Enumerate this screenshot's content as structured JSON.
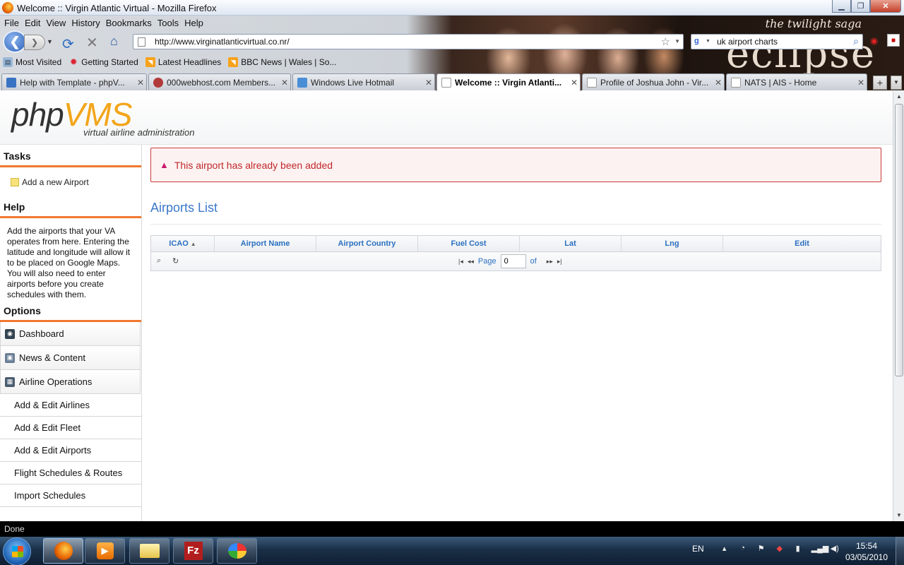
{
  "window": {
    "title": "Welcome :: Virgin Atlantic Virtual - Mozilla Firefox",
    "controls": {
      "minimize": "▁",
      "maximize": "❐",
      "close": "✕"
    }
  },
  "banner": {
    "brand": "eclipse",
    "saga": "the twilight saga"
  },
  "menu": [
    "File",
    "Edit",
    "View",
    "History",
    "Bookmarks",
    "Tools",
    "Help"
  ],
  "nav": {
    "url": "http://www.virginatlanticvirtual.co.nr/",
    "search_query": "uk airport charts"
  },
  "bookmarks": [
    {
      "label": "Most Visited",
      "icon": "most-visited-icon"
    },
    {
      "label": "Getting Started",
      "icon": "star-icon"
    },
    {
      "label": "Latest Headlines",
      "icon": "rss-icon"
    },
    {
      "label": "BBC News | Wales | So...",
      "icon": "rss-icon"
    }
  ],
  "tabs": [
    {
      "label": "Help with Template - phpV...",
      "active": false
    },
    {
      "label": "000webhost.com Members...",
      "active": false
    },
    {
      "label": "Windows Live Hotmail",
      "active": false
    },
    {
      "label": "Welcome :: Virgin Atlanti...",
      "active": true
    },
    {
      "label": "Profile of Joshua John - Vir...",
      "active": false
    },
    {
      "label": "NATS | AIS - Home",
      "active": false
    }
  ],
  "logo": {
    "php": "php",
    "vms": "VMS",
    "tagline": "virtual airline administration"
  },
  "sidebar": {
    "tasks_heading": "Tasks",
    "task_link": "Add a new Airport",
    "help_heading": "Help",
    "help_text": "Add the airports that your VA operates from here. Entering the latitude and longitude will allow it to be placed on Google Maps. You will also need to enter airports before you create schedules with them.",
    "options_heading": "Options",
    "options": [
      "Dashboard",
      "News & Content",
      "Airline Operations"
    ],
    "sub_items": [
      "Add & Edit Airlines",
      "Add & Edit Fleet",
      "Add & Edit Airports",
      "Flight Schedules & Routes",
      "Import Schedules"
    ]
  },
  "main": {
    "alert": "This airport has already been added",
    "title": "Airports List",
    "columns": [
      "ICAO",
      "Airport Name",
      "Airport Country",
      "Fuel Cost",
      "Lat",
      "Lng",
      "Edit"
    ],
    "pager": {
      "page_label": "Page",
      "page_value": "0",
      "of_label": "of"
    }
  },
  "status": "Done",
  "taskbar": {
    "lang": "EN",
    "time": "15:54",
    "date": "03/05/2010"
  }
}
